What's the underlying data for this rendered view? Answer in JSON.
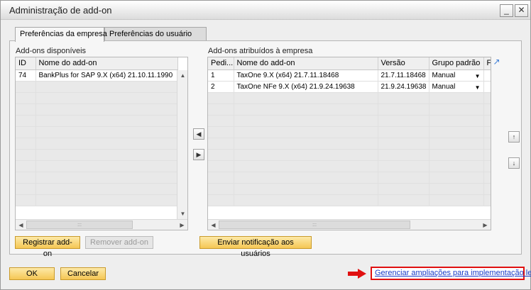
{
  "window": {
    "title": "Administração de add-on",
    "minimize_glyph": "_",
    "close_glyph": "✕"
  },
  "tabs": [
    {
      "label": "Preferências da empresa",
      "active": true
    },
    {
      "label": "Preferências do usuário",
      "active": false
    }
  ],
  "available": {
    "label": "Add-ons disponíveis",
    "columns": [
      "ID",
      "Nome do add-on"
    ],
    "rows": [
      {
        "id": "74",
        "name": "BankPlus for SAP 9.X (x64) 21.10.11.1990"
      }
    ]
  },
  "assigned": {
    "label": "Add-ons atribuídos à empresa",
    "columns": [
      "Pedi...",
      "Nome do add-on",
      "Versão",
      "Grupo padrão",
      "F"
    ],
    "rows": [
      {
        "order": "1",
        "name": "TaxOne 9.X (x64) 21.7.11.18468",
        "version": "21.7.11.18468",
        "group": "Manual"
      },
      {
        "order": "2",
        "name": "TaxOne NFe 9.X (x64) 21.9.24.19638",
        "version": "21.9.24.19638",
        "group": "Manual"
      }
    ]
  },
  "buttons": {
    "register": "Registrar add-on",
    "remove": "Remover add-on",
    "notify": "Enviar notificação aos usuários",
    "ok": "OK",
    "cancel": "Cancelar"
  },
  "link": {
    "text": "Gerenciar ampliações para implementação leve"
  },
  "icons": {
    "expand": "↗",
    "move_left": "◀",
    "move_right": "▶",
    "move_up": "↑",
    "move_down": "↓",
    "dropdown": "▼",
    "scroll_up": "▲",
    "scroll_down": "▼",
    "scroll_left": "◀",
    "scroll_right": "▶",
    "thumb_grip": ":::"
  },
  "colors": {
    "button_bg": "#f5c754",
    "link": "#1a3cc8",
    "highlight": "#e01010"
  }
}
